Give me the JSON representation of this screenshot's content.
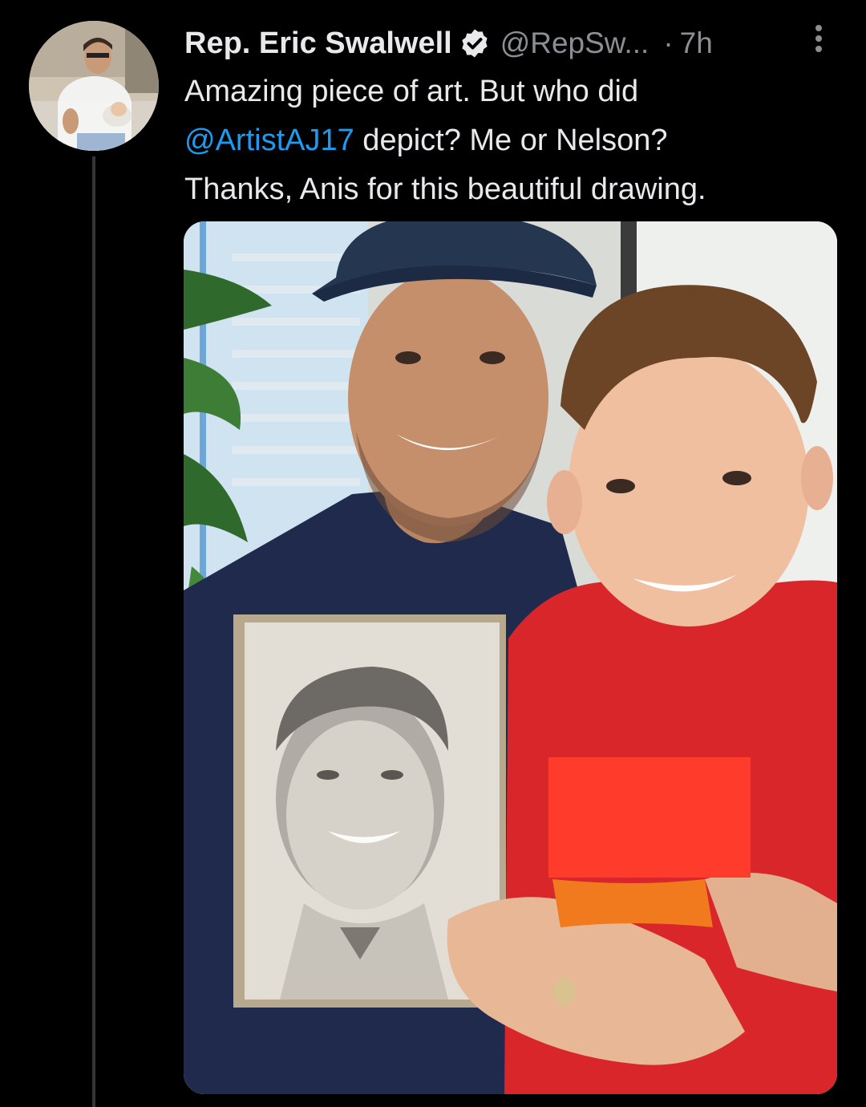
{
  "tweet": {
    "author_name": "Rep. Eric Swalwell",
    "handle": "@RepSw...",
    "separator": "·",
    "time": "7h",
    "text_line1": "Amazing piece of art. But who did",
    "mention": "@ArtistAJ17",
    "text_line2_rest": " depict? Me or Nelson?",
    "text_line3": "Thanks, Anis for this beautiful drawing.",
    "verified_icon": "verified-badge-icon",
    "more_icon": "more-vertical-icon"
  },
  "colors": {
    "background": "#000000",
    "text": "#e7e9ea",
    "secondary": "#8b8f94",
    "link": "#1d9bf0",
    "redaction": "#ff3b2b"
  }
}
